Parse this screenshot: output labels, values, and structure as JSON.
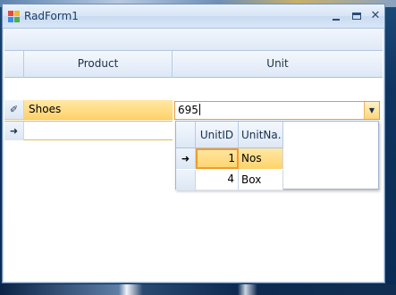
{
  "window": {
    "title": "RadForm1",
    "minimize_glyph": "_",
    "close_glyph": "✕"
  },
  "grid": {
    "columns": [
      "Product",
      "Unit"
    ],
    "rows": [
      {
        "indicator": "edit-pencil-icon",
        "indicator_glyph": "✐",
        "product": "Shoes"
      },
      {
        "indicator": "current-row-arrow-icon",
        "indicator_glyph": "➜",
        "product": ""
      }
    ]
  },
  "combo": {
    "value": "695",
    "arrow_glyph": "▼"
  },
  "dropdown": {
    "columns": [
      "UnitID",
      "UnitNa..."
    ],
    "rows": [
      {
        "indicator_glyph": "➜",
        "unit_id": "1",
        "unit_name": "Nos"
      },
      {
        "indicator_glyph": "",
        "unit_id": "4",
        "unit_name": "Box"
      }
    ]
  },
  "colors": {
    "selection": "#ffd36b",
    "header": "#dde8f6",
    "accent_border": "#e59a3c"
  }
}
